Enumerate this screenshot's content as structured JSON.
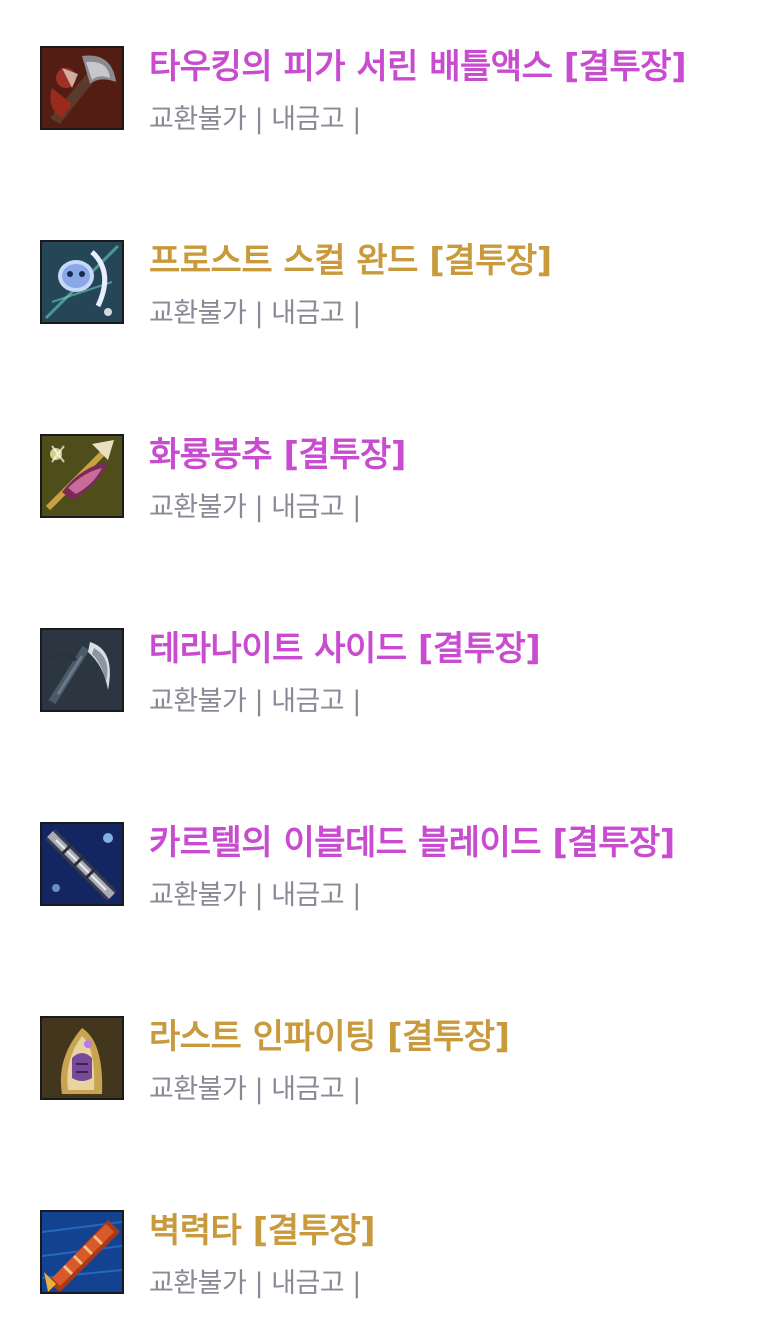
{
  "colors": {
    "grade_relic": "#c84bd0",
    "grade_ancient": "#c89a3c",
    "meta_text": "#8a8a96"
  },
  "items": [
    {
      "name": "타우킹의 피가 서린 배틀액스 [결투장]",
      "grade": "relic",
      "meta": "교환불가 | 내금고 |",
      "icon": "battle-axe-icon"
    },
    {
      "name": "프로스트 스컬 완드 [결투장]",
      "grade": "ancient",
      "meta": "교환불가 | 내금고 |",
      "icon": "frost-skull-wand-icon"
    },
    {
      "name": "화룡봉추 [결투장]",
      "grade": "relic",
      "meta": "교환불가 | 내금고 |",
      "icon": "dragon-staff-icon"
    },
    {
      "name": "테라나이트 사이드 [결투장]",
      "grade": "relic",
      "meta": "교환불가 | 내금고 |",
      "icon": "scythe-icon"
    },
    {
      "name": "카르텔의 이블데드 블레이드 [결투장]",
      "grade": "relic",
      "meta": "교환불가 | 내금고 |",
      "icon": "evil-dead-blade-icon"
    },
    {
      "name": "라스트 인파이팅 [결투장]",
      "grade": "ancient",
      "meta": "교환불가 | 내금고 |",
      "icon": "gauntlet-icon"
    },
    {
      "name": "벽력타 [결투장]",
      "grade": "ancient",
      "meta": "교환불가 | 내금고 |",
      "icon": "thunder-knuckle-icon"
    }
  ]
}
